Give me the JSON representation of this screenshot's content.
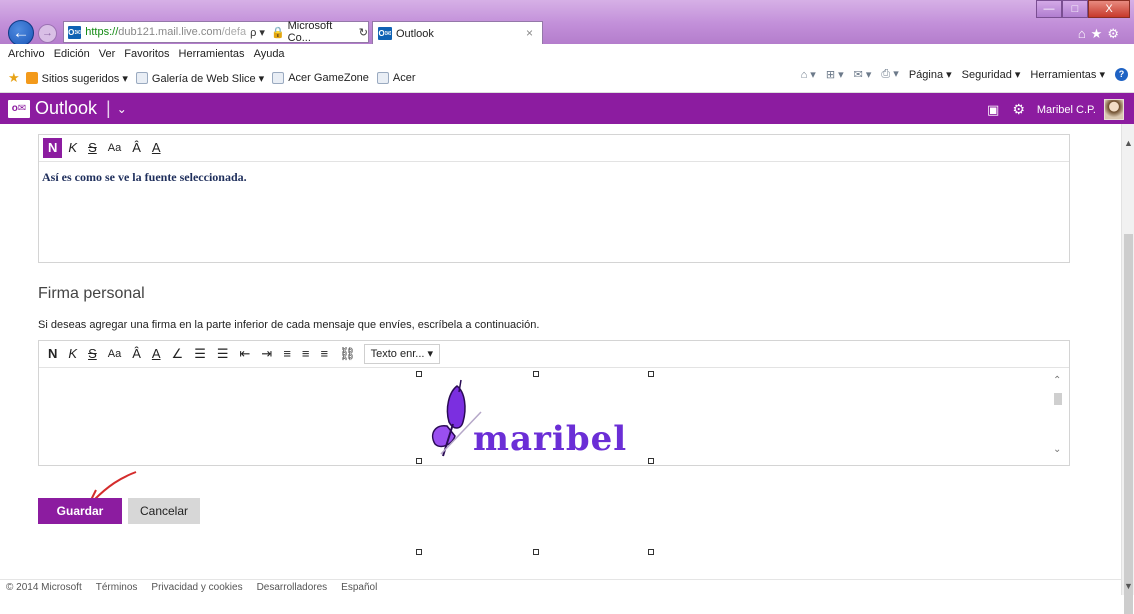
{
  "browser": {
    "address": {
      "https": "https://",
      "host": "dub121.mail.live.com",
      "rest": "/defa",
      "search_glyph": "ρ ▾",
      "site_title": "Microsoft Co...",
      "refresh_glyph": "↻"
    },
    "tab": {
      "title": "Outlook",
      "close": "×"
    },
    "window_buttons": {
      "minimize": "—",
      "maximize": "□",
      "close": "X"
    },
    "chrome_icons": "⌂★⚙"
  },
  "menubar": [
    "Archivo",
    "Edición",
    "Ver",
    "Favoritos",
    "Herramientas",
    "Ayuda"
  ],
  "favorites": [
    {
      "label": "Sitios sugeridos ▾",
      "icon": "sites-icon"
    },
    {
      "label": "Galería de Web Slice ▾",
      "icon": "web-slice-icon"
    },
    {
      "label": "Acer GameZone",
      "icon": "page-icon"
    },
    {
      "label": "Acer",
      "icon": "page-icon"
    }
  ],
  "commandbar": {
    "home": "⌂ ▾",
    "feeds": "⊞ ▾",
    "mail": "✉ ▾",
    "print": "⎙ ▾",
    "page": "Página ▾",
    "security": "Seguridad ▾",
    "tools": "Herramientas ▾",
    "help": "?"
  },
  "outlook": {
    "logo": "o✉",
    "name": "Outlook",
    "separator": "|",
    "chevron": "⌄",
    "user": "Maribel C.P.",
    "chat_icon": "💬",
    "gear_icon": "⚙"
  },
  "font_box": {
    "toolbar": {
      "bold": "N",
      "italic": "K",
      "underline": "S",
      "size": "Aa",
      "grow": "Â",
      "color": "A"
    },
    "preview": "Así es como se ve la fuente seleccionada."
  },
  "signature": {
    "heading": "Firma personal",
    "description": "Si deseas agregar una firma en la parte inferior de cada mensaje que envíes, escríbela a continuación.",
    "toolbar": {
      "bold": "N",
      "italic": "K",
      "underline": "S",
      "size": "Aa",
      "grow": "Â",
      "color": "A",
      "highlight": "∠",
      "numbered": "☰",
      "bulleted": "☰",
      "outdent": "⇤",
      "indent": "⇥",
      "align_left": "≡",
      "align_center": "≡",
      "align_right": "≡",
      "link": "⛓",
      "text_mode": "Texto enr... ▾"
    },
    "image_text": "maribel",
    "image_colors": {
      "wing": "#7b2fe0",
      "text": "#6b2ed6",
      "arrow": "#d42c2c"
    }
  },
  "buttons": {
    "save": "Guardar",
    "cancel": "Cancelar"
  },
  "footer": [
    "© 2014 Microsoft",
    "Términos",
    "Privacidad y cookies",
    "Desarrolladores",
    "Español"
  ]
}
